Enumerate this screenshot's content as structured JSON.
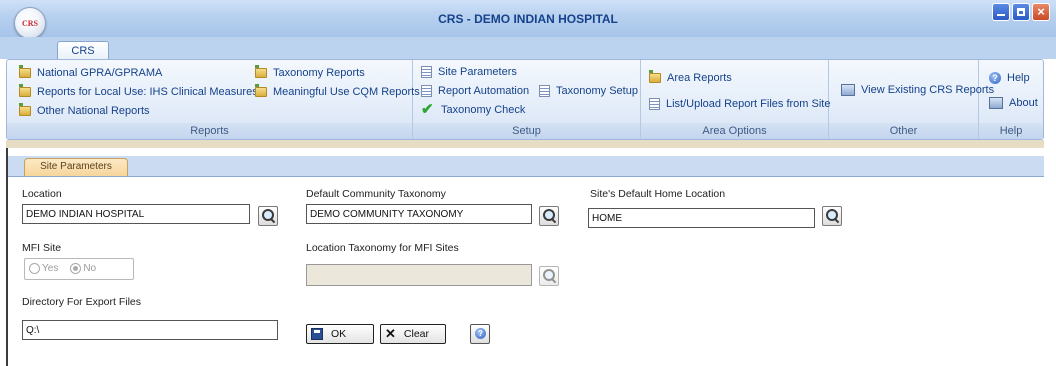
{
  "window": {
    "title": "CRS - DEMO INDIAN HOSPITAL",
    "app_logo_text": "CRS"
  },
  "ribbon_tabs": [
    "CRS"
  ],
  "ribbon": {
    "reports": {
      "label": "Reports",
      "items": {
        "national_gpra": "National GPRA/GPRAMA",
        "local_use": "Reports for Local Use: IHS Clinical Measures",
        "other_national": "Other National Reports",
        "taxonomy_reports": "Taxonomy Reports",
        "meaningful_use": "Meaningful Use CQM Reports"
      }
    },
    "setup": {
      "label": "Setup",
      "items": {
        "site_parameters": "Site Parameters",
        "report_automation": "Report Automation",
        "taxonomy_setup": "Taxonomy Setup",
        "taxonomy_check": "Taxonomy Check"
      }
    },
    "area_options": {
      "label": "Area Options",
      "items": {
        "area_reports": "Area Reports",
        "list_upload": "List/Upload Report Files from Site"
      }
    },
    "other": {
      "label": "Other",
      "items": {
        "view_existing": "View Existing CRS Reports"
      }
    },
    "help": {
      "label": "Help",
      "items": {
        "help": "Help",
        "about": "About"
      }
    }
  },
  "content": {
    "tab": "Site Parameters",
    "location": {
      "label": "Location",
      "value": "DEMO INDIAN HOSPITAL"
    },
    "default_taxonomy": {
      "label": "Default Community Taxonomy",
      "value": "DEMO COMMUNITY TAXONOMY"
    },
    "home_location": {
      "label": "Site's Default Home Location",
      "value": "HOME"
    },
    "mfi_site": {
      "label": "MFI Site",
      "yes": "Yes",
      "no": "No",
      "selected": "No"
    },
    "mfi_taxonomy": {
      "label": "Location Taxonomy for MFI Sites",
      "value": ""
    },
    "export_dir": {
      "label": "Directory For Export Files",
      "value": "Q:\\"
    },
    "ok_button": "OK",
    "clear_button": "Clear"
  }
}
